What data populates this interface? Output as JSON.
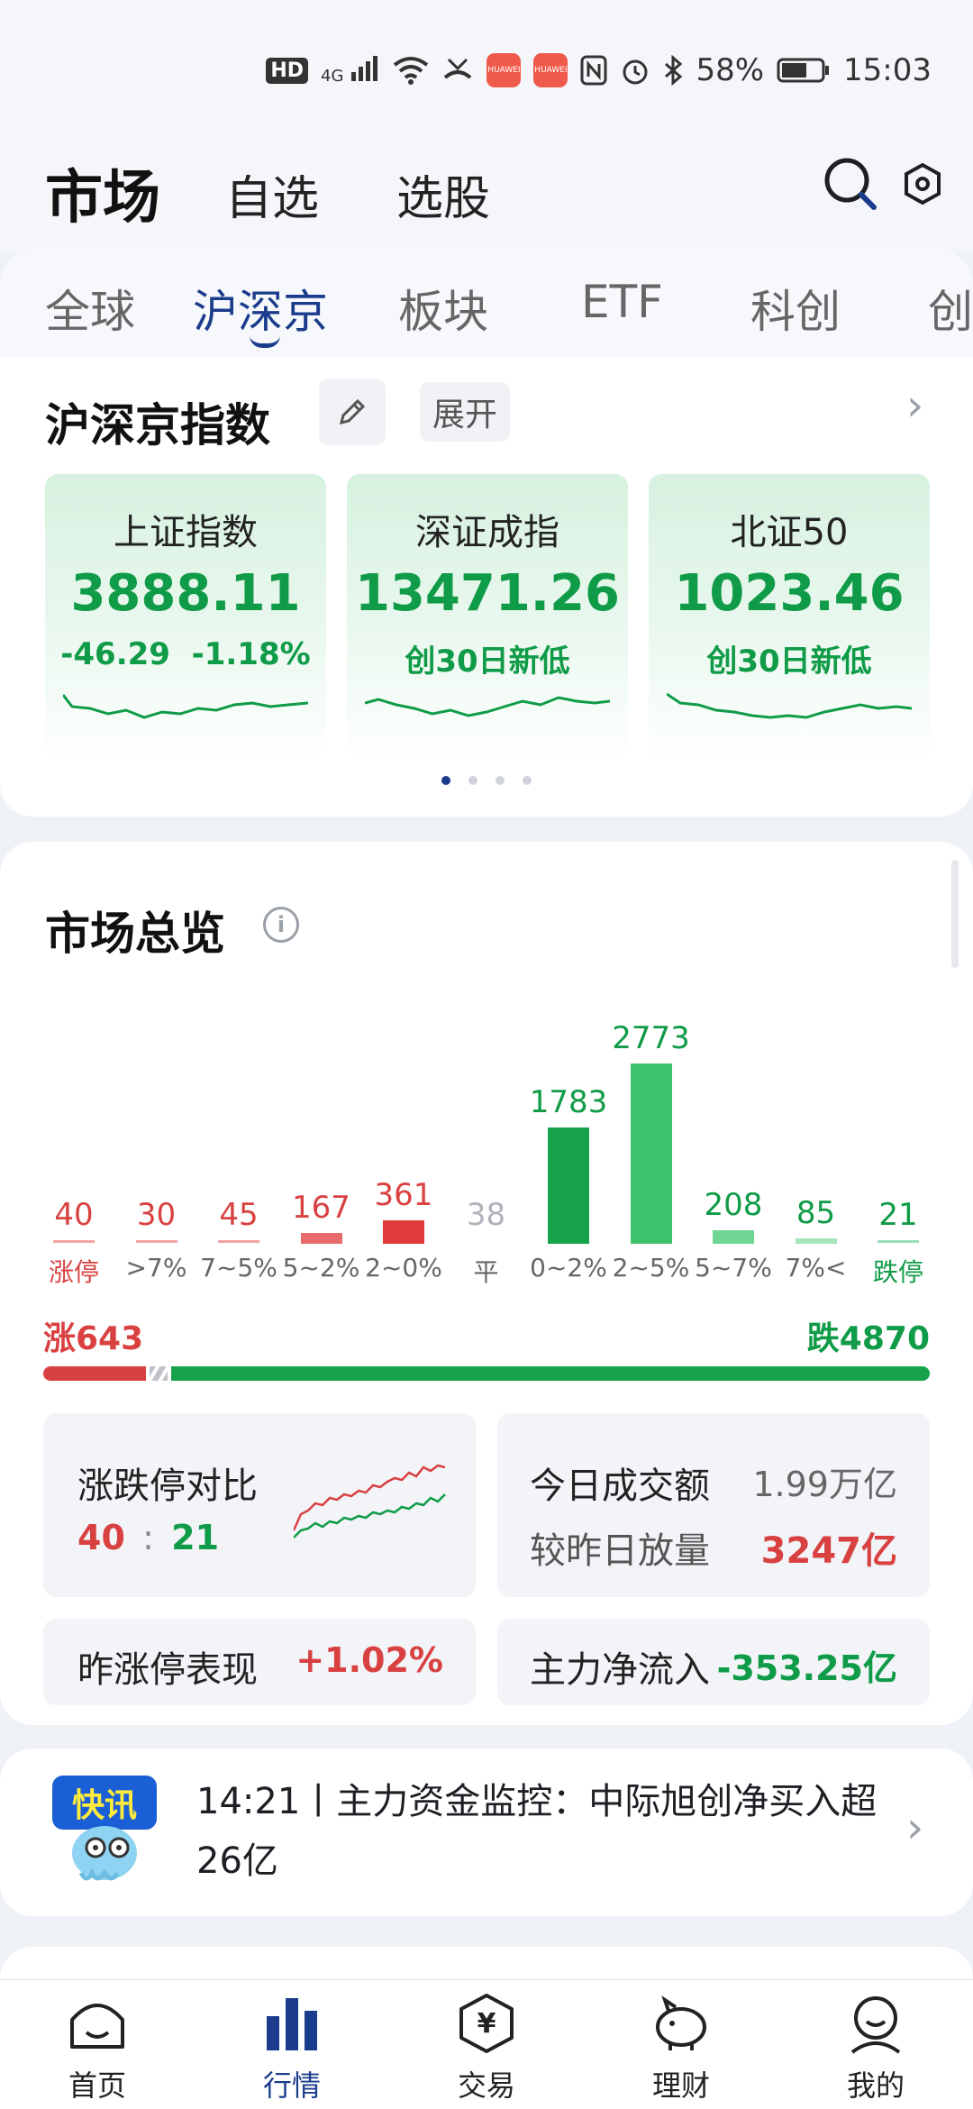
{
  "status_bar": {
    "hd": "HD",
    "network": "4G",
    "battery": "58%",
    "time": "15:03"
  },
  "header": {
    "title": "市场",
    "tabs": [
      "自选",
      "选股"
    ],
    "icons": [
      "search-icon",
      "settings-icon"
    ]
  },
  "sub_tabs": {
    "items": [
      "全球",
      "沪深京",
      "板块",
      "ETF",
      "科创",
      "创"
    ],
    "active_index": 1
  },
  "index_section": {
    "title": "沪深京指数",
    "expand_label": "展开",
    "indices": [
      {
        "name": "上证指数",
        "value": "3888.11",
        "change": "-46.29",
        "change_pct": "-1.18%",
        "note": ""
      },
      {
        "name": "深证成指",
        "value": "13471.26",
        "change": "",
        "change_pct": "",
        "note": "创30日新低"
      },
      {
        "name": "北证50",
        "value": "1023.46",
        "change": "",
        "change_pct": "",
        "note": "创30日新低"
      }
    ],
    "page_dots": 4,
    "active_dot": 0
  },
  "overview": {
    "title": "市场总览",
    "chart_data": {
      "type": "bar",
      "categories": [
        "涨停",
        ">7%",
        "7~5%",
        "5~2%",
        "2~0%",
        "平",
        "0~2%",
        "2~5%",
        "5~7%",
        "7%<",
        "跌停"
      ],
      "values": [
        40,
        30,
        45,
        167,
        361,
        38,
        1783,
        2773,
        208,
        85,
        21
      ],
      "colors": [
        "#d94141",
        "#d94141",
        "#d94141",
        "#e86a6a",
        "#e03b3b",
        "#bfc3c9",
        "#16a34a",
        "#3cc26a",
        "#6fd494",
        "#a7e3bd",
        "#0f9b47"
      ],
      "title": "",
      "xlabel": "",
      "ylabel": "",
      "ylim": [
        0,
        2773
      ]
    },
    "rise_label": "涨643",
    "fall_label": "跌4870",
    "rise_count": 643,
    "flat_count": 38,
    "fall_count": 4870,
    "limit_compare": {
      "title": "涨跌停对比",
      "up": "40",
      "sep": ":",
      "down": "21"
    },
    "turnover": {
      "title": "今日成交额",
      "value": "1.99万亿",
      "vs_label": "较昨日放量",
      "vs_value": "3247亿"
    },
    "yday_limit": {
      "title": "昨涨停表现",
      "value": "+1.02%"
    },
    "main_flow": {
      "title": "主力净流入",
      "value": "-353.25亿"
    }
  },
  "news": {
    "badge": "快讯",
    "text": "14:21丨主力资金监控：中际旭创净买入超26亿"
  },
  "bottom_nav": {
    "items": [
      "首页",
      "行情",
      "交易",
      "理财",
      "我的"
    ],
    "active_index": 1,
    "trade_symbol": "¥"
  },
  "colors": {
    "accent": "#1b3c8c",
    "up": "#d94141",
    "down": "#0f9b47"
  }
}
